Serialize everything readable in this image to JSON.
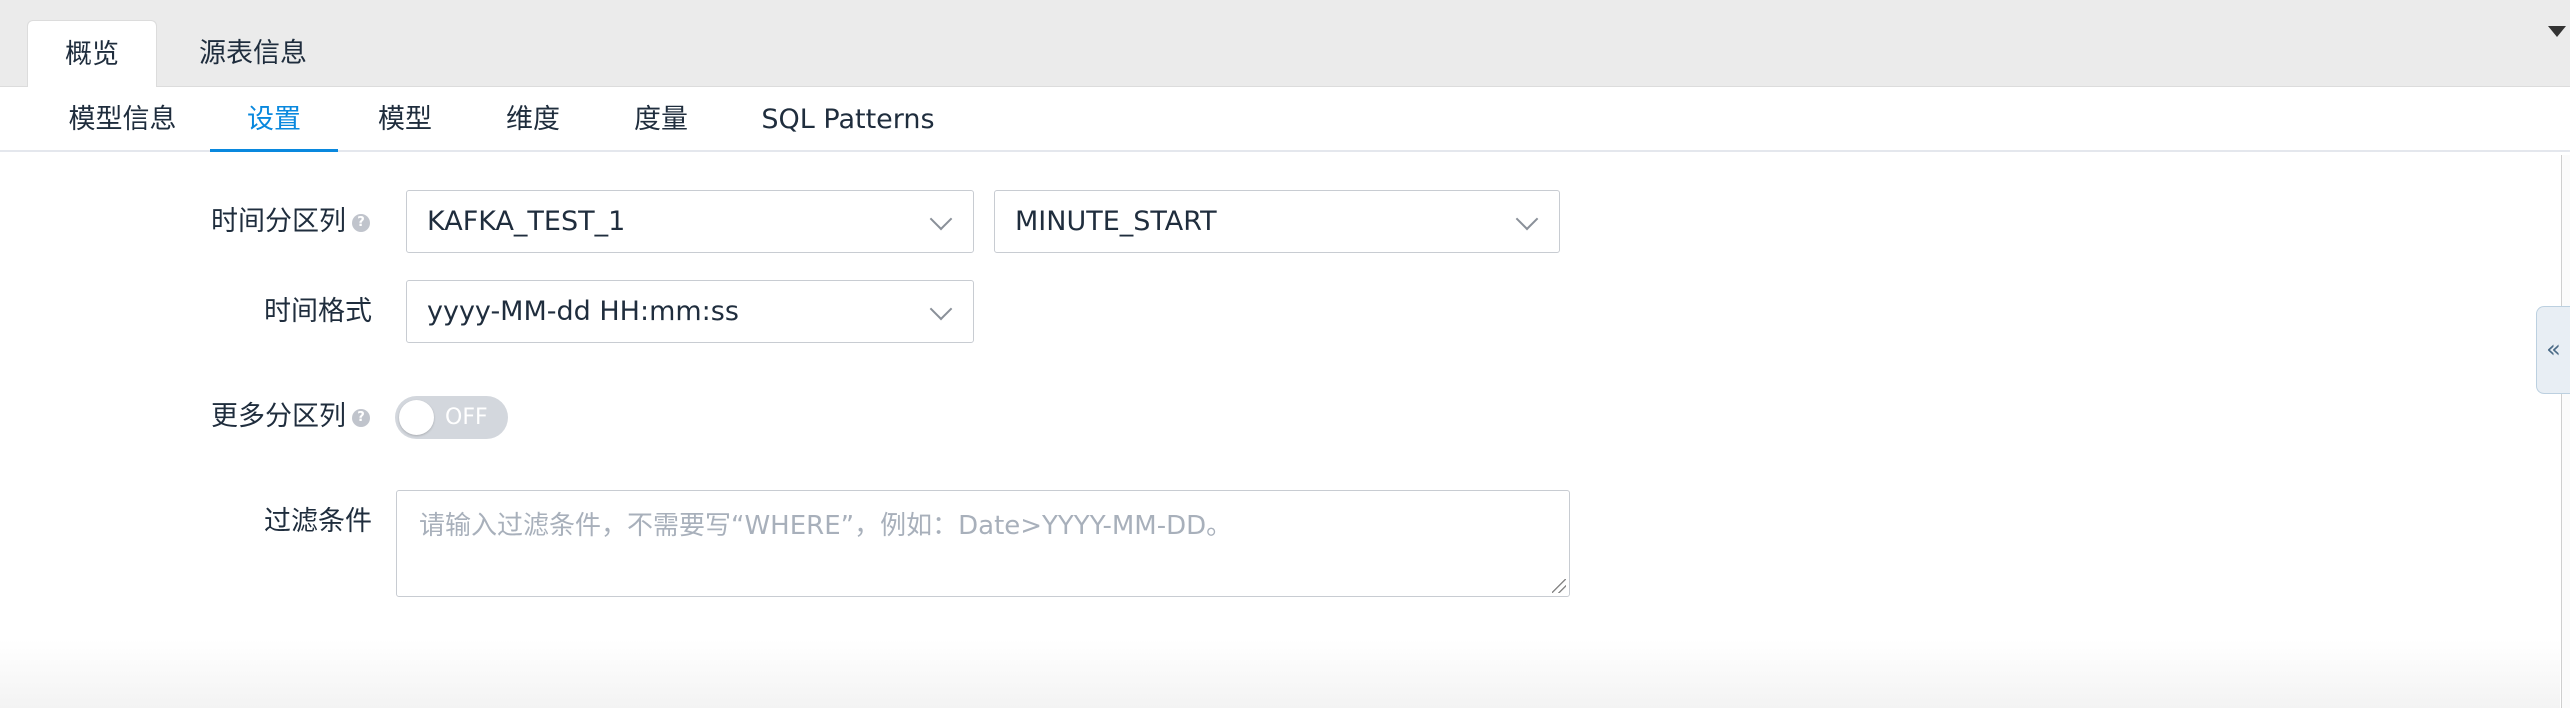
{
  "top_tabs": [
    {
      "label": "概览",
      "active": true
    },
    {
      "label": "源表信息",
      "active": false
    }
  ],
  "sub_tabs": [
    {
      "label": "模型信息",
      "active": false
    },
    {
      "label": "设置",
      "active": true
    },
    {
      "label": "模型",
      "active": false
    },
    {
      "label": "维度",
      "active": false
    },
    {
      "label": "度量",
      "active": false
    },
    {
      "label": "SQL Patterns",
      "active": false
    }
  ],
  "form": {
    "partition_label": "时间分区列",
    "partition_table": "KAFKA_TEST_1",
    "partition_column": "MINUTE_START",
    "time_format_label": "时间格式",
    "time_format": "yyyy-MM-dd HH:mm:ss",
    "more_partition_label": "更多分区列",
    "more_partition_toggle": "OFF",
    "filter_label": "过滤条件",
    "filter_placeholder": "请输入过滤条件，不需要写“WHERE”，例如：Date>YYYY-MM-DD。"
  },
  "icons": {
    "help": "question-circle-icon",
    "collapse": "double-chevron-left-icon",
    "dropdown": "chevron-down-icon"
  },
  "colors": {
    "accent": "#0988de",
    "tab_bar_bg": "#ebebeb",
    "toggle_off": "#d3d7dd"
  }
}
